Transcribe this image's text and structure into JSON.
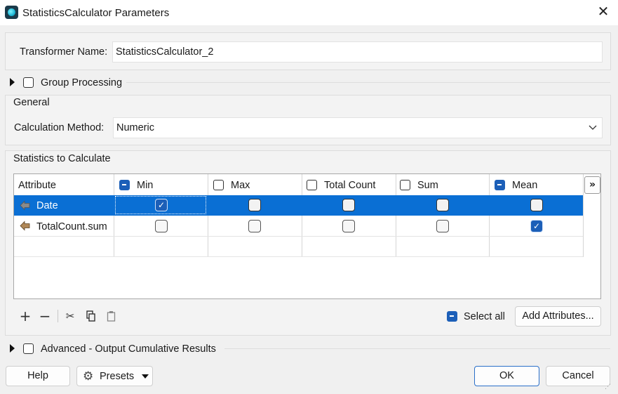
{
  "window": {
    "title": "StatisticsCalculator Parameters"
  },
  "transformer": {
    "label": "Transformer Name:",
    "value": "StatisticsCalculator_2"
  },
  "group_processing": {
    "label": "Group Processing",
    "checked": false
  },
  "general": {
    "section_label": "General",
    "method_label": "Calculation Method:",
    "method_value": "Numeric"
  },
  "stats": {
    "section_label": "Statistics to Calculate",
    "columns": [
      "Attribute",
      "Min",
      "Max",
      "Total Count",
      "Sum",
      "Mean"
    ],
    "column_states": [
      "none",
      "indeterminate",
      "unchecked",
      "unchecked",
      "unchecked",
      "indeterminate"
    ],
    "more_columns": "»",
    "rows": [
      {
        "attribute": "Date",
        "selected": true,
        "min": true,
        "max": false,
        "total_count": false,
        "sum": false,
        "mean": false
      },
      {
        "attribute": "TotalCount.sum",
        "selected": false,
        "min": false,
        "max": false,
        "total_count": false,
        "sum": false,
        "mean": true
      }
    ],
    "select_all_label": "Select all",
    "add_attributes_label": "Add Attributes..."
  },
  "advanced": {
    "label": "Advanced - Output Cumulative Results",
    "checked": false
  },
  "footer": {
    "help": "Help",
    "presets": "Presets",
    "ok": "OK",
    "cancel": "Cancel"
  },
  "colors": {
    "accent": "#1c5fb8",
    "selection": "#0a6fd4"
  }
}
